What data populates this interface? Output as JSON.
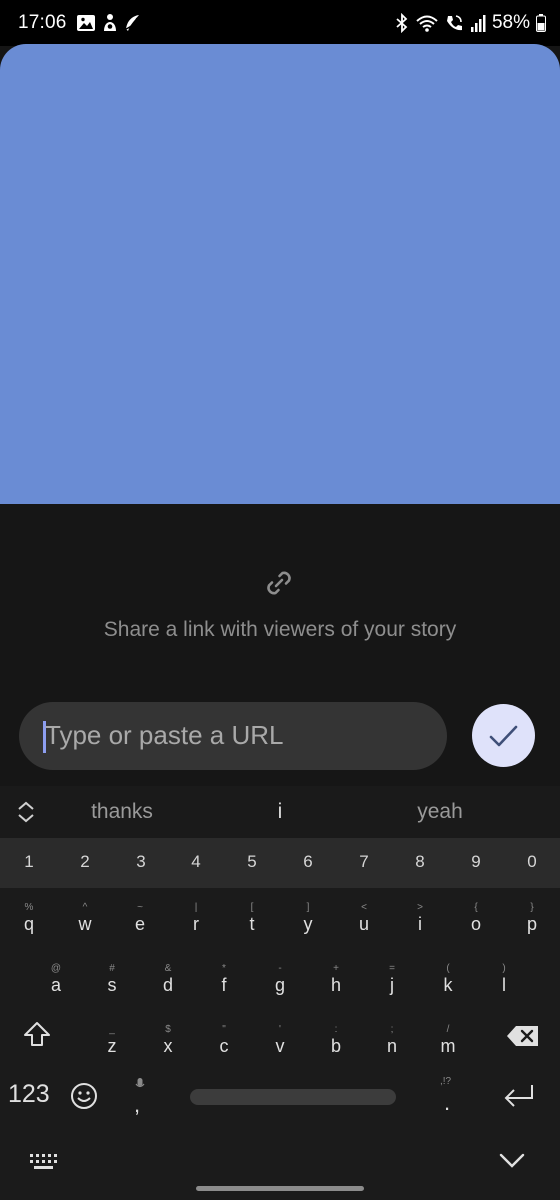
{
  "status_bar": {
    "time": "17:06",
    "battery": "58%",
    "icons": [
      "gallery-icon",
      "figure-icon",
      "feather-icon",
      "bluetooth-icon",
      "wifi-icon",
      "call-icon",
      "signal-icon",
      "battery-icon"
    ]
  },
  "story": {
    "background_color": "#6a8cd4"
  },
  "link_prompt": {
    "icon": "link-icon",
    "caption": "Share a link with viewers of your story"
  },
  "url_input": {
    "placeholder": "Type or paste a URL",
    "value": ""
  },
  "confirm_button": {
    "icon": "checkmark-icon"
  },
  "keyboard": {
    "suggestions": [
      "thanks",
      "i",
      "yeah"
    ],
    "numbers": [
      "1",
      "2",
      "3",
      "4",
      "5",
      "6",
      "7",
      "8",
      "9",
      "0"
    ],
    "row1": [
      {
        "key": "q",
        "hint": "%"
      },
      {
        "key": "w",
        "hint": "^"
      },
      {
        "key": "e",
        "hint": "~"
      },
      {
        "key": "r",
        "hint": "|"
      },
      {
        "key": "t",
        "hint": "["
      },
      {
        "key": "y",
        "hint": "]"
      },
      {
        "key": "u",
        "hint": "<"
      },
      {
        "key": "i",
        "hint": ">"
      },
      {
        "key": "o",
        "hint": "{"
      },
      {
        "key": "p",
        "hint": "}"
      }
    ],
    "row2": [
      {
        "key": "a",
        "hint": "@"
      },
      {
        "key": "s",
        "hint": "#"
      },
      {
        "key": "d",
        "hint": "&"
      },
      {
        "key": "f",
        "hint": "*"
      },
      {
        "key": "g",
        "hint": "-"
      },
      {
        "key": "h",
        "hint": "+"
      },
      {
        "key": "j",
        "hint": "="
      },
      {
        "key": "k",
        "hint": "("
      },
      {
        "key": "l",
        "hint": ")"
      }
    ],
    "row3": [
      {
        "key": "z",
        "hint": "_"
      },
      {
        "key": "x",
        "hint": "$"
      },
      {
        "key": "c",
        "hint": "\""
      },
      {
        "key": "v",
        "hint": "'"
      },
      {
        "key": "b",
        "hint": ":"
      },
      {
        "key": "n",
        "hint": ";"
      },
      {
        "key": "m",
        "hint": "/"
      }
    ],
    "symbols_label": "123",
    "comma": ",",
    "period": ".",
    "period_hint": ",!?"
  }
}
